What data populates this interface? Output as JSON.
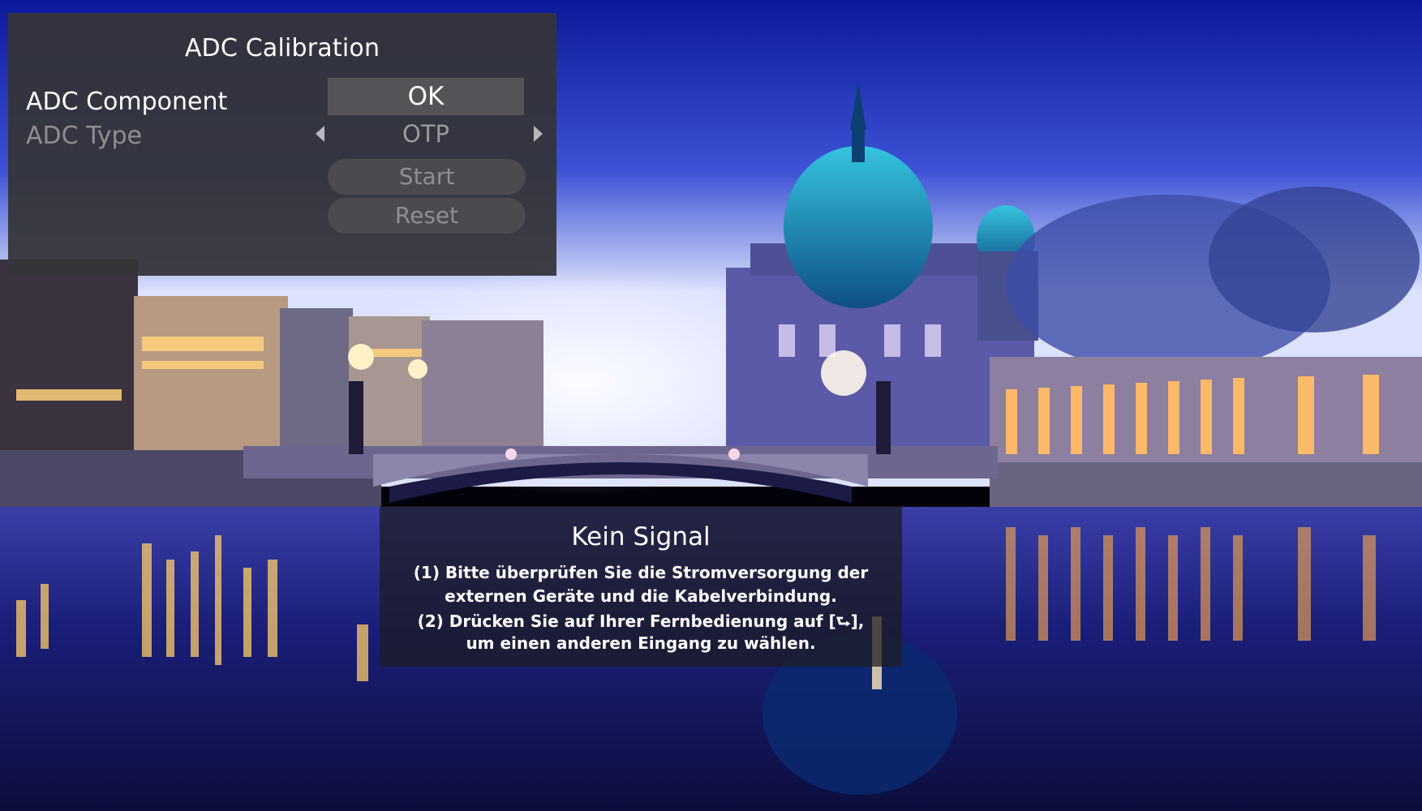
{
  "adc_panel": {
    "title": "ADC Calibration",
    "rows": [
      {
        "label": "ADC Component",
        "value": "OK"
      },
      {
        "label": "ADC Type",
        "value": "OTP"
      }
    ],
    "buttons": {
      "start": "Start",
      "reset": "Reset"
    }
  },
  "no_signal": {
    "title": "Kein Signal",
    "lines": [
      "(1) Bitte überprüfen Sie die Stromversorgung der",
      "externen Geräte und die Kabelverbindung.",
      "(2) Drücken Sie auf Ihrer Fernbedienung auf [⮑],",
      "um einen anderen Eingang zu wählen."
    ]
  },
  "colors": {
    "panel_bg": "#343438",
    "highlight": "#545458",
    "dim_text": "#8e8e92",
    "sky_top": "#0b1aa0",
    "water": "#10104a"
  },
  "icons": {
    "left_arrow": "triangle-left",
    "right_arrow": "triangle-right",
    "input_key": "input-source-icon"
  }
}
